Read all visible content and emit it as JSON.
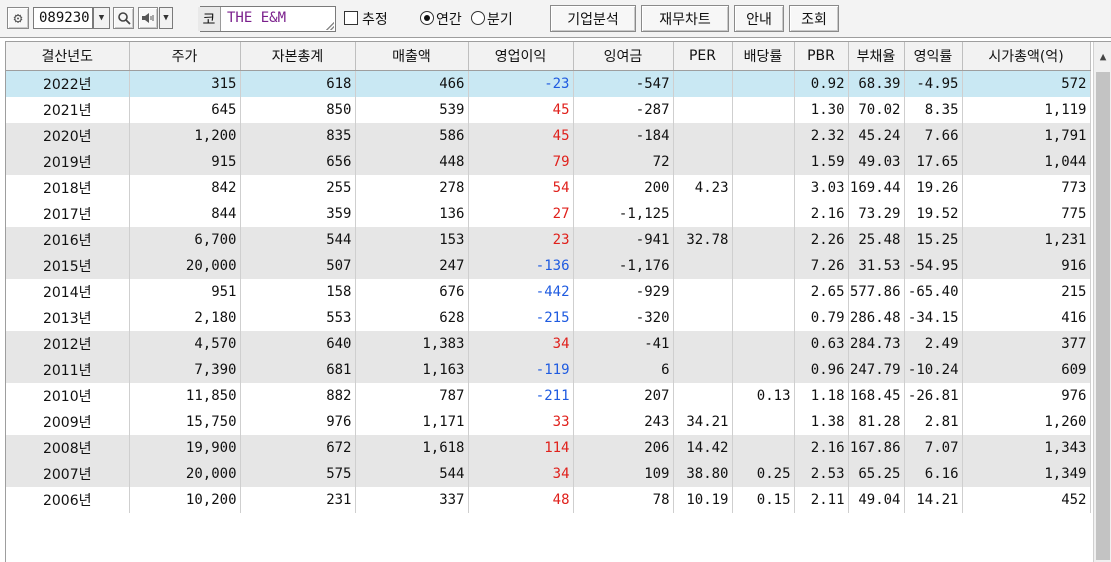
{
  "toolbar": {
    "stock_code": "089230",
    "market": "코",
    "company_name": "THE E&M",
    "estimate_label": "추정",
    "annual_label": "연간",
    "quarterly_label": "분기",
    "selected_period": "annual",
    "buttons": [
      "기업분석",
      "재무차트",
      "안내",
      "조회"
    ]
  },
  "table": {
    "headers": [
      "결산년도",
      "주가",
      "자본총계",
      "매출액",
      "영업이익",
      "잉여금",
      "PER",
      "배당률",
      "PBR",
      "부채율",
      "영익률",
      "시가총액(억)"
    ],
    "rows": [
      [
        "2022년",
        "315",
        "618",
        "466",
        "-23",
        "-547",
        "",
        "",
        "0.92",
        "68.39",
        "-4.95",
        "572"
      ],
      [
        "2021년",
        "645",
        "850",
        "539",
        "45",
        "-287",
        "",
        "",
        "1.30",
        "70.02",
        "8.35",
        "1,119"
      ],
      [
        "2020년",
        "1,200",
        "835",
        "586",
        "45",
        "-184",
        "",
        "",
        "2.32",
        "45.24",
        "7.66",
        "1,791"
      ],
      [
        "2019년",
        "915",
        "656",
        "448",
        "79",
        "72",
        "",
        "",
        "1.59",
        "49.03",
        "17.65",
        "1,044"
      ],
      [
        "2018년",
        "842",
        "255",
        "278",
        "54",
        "200",
        "4.23",
        "",
        "3.03",
        "169.44",
        "19.26",
        "773"
      ],
      [
        "2017년",
        "844",
        "359",
        "136",
        "27",
        "-1,125",
        "",
        "",
        "2.16",
        "73.29",
        "19.52",
        "775"
      ],
      [
        "2016년",
        "6,700",
        "544",
        "153",
        "23",
        "-941",
        "32.78",
        "",
        "2.26",
        "25.48",
        "15.25",
        "1,231"
      ],
      [
        "2015년",
        "20,000",
        "507",
        "247",
        "-136",
        "-1,176",
        "",
        "",
        "7.26",
        "31.53",
        "-54.95",
        "916"
      ],
      [
        "2014년",
        "951",
        "158",
        "676",
        "-442",
        "-929",
        "",
        "",
        "2.65",
        "577.86",
        "-65.40",
        "215"
      ],
      [
        "2013년",
        "2,180",
        "553",
        "628",
        "-215",
        "-320",
        "",
        "",
        "0.79",
        "286.48",
        "-34.15",
        "416"
      ],
      [
        "2012년",
        "4,570",
        "640",
        "1,383",
        "34",
        "-41",
        "",
        "",
        "0.63",
        "284.73",
        "2.49",
        "377"
      ],
      [
        "2011년",
        "7,390",
        "681",
        "1,163",
        "-119",
        "6",
        "",
        "",
        "0.96",
        "247.79",
        "-10.24",
        "609"
      ],
      [
        "2010년",
        "11,850",
        "882",
        "787",
        "-211",
        "207",
        "",
        "0.13",
        "1.18",
        "168.45",
        "-26.81",
        "976"
      ],
      [
        "2009년",
        "15,750",
        "976",
        "1,171",
        "33",
        "243",
        "34.21",
        "",
        "1.38",
        "81.28",
        "2.81",
        "1,260"
      ],
      [
        "2008년",
        "19,900",
        "672",
        "1,618",
        "114",
        "206",
        "14.42",
        "",
        "2.16",
        "167.86",
        "7.07",
        "1,343"
      ],
      [
        "2007년",
        "20,000",
        "575",
        "544",
        "34",
        "109",
        "38.80",
        "0.25",
        "2.53",
        "65.25",
        "6.16",
        "1,349"
      ],
      [
        "2006년",
        "10,200",
        "231",
        "337",
        "48",
        "78",
        "10.19",
        "0.15",
        "2.11",
        "49.04",
        "14.21",
        "452"
      ]
    ],
    "selected_row": 0
  },
  "icons": {
    "gear": "gear-icon",
    "dropdown": "chevron-down-icon",
    "search": "search-icon",
    "speaker": "speaker-icon",
    "scroll_up": "arrow-up-icon"
  },
  "colors": {
    "positive": "#e0211c",
    "negative": "#1f5be0",
    "selected_row": "#c9e8f3",
    "shaded_row": "#e6e6e6",
    "company_name": "#7a1f8c"
  }
}
